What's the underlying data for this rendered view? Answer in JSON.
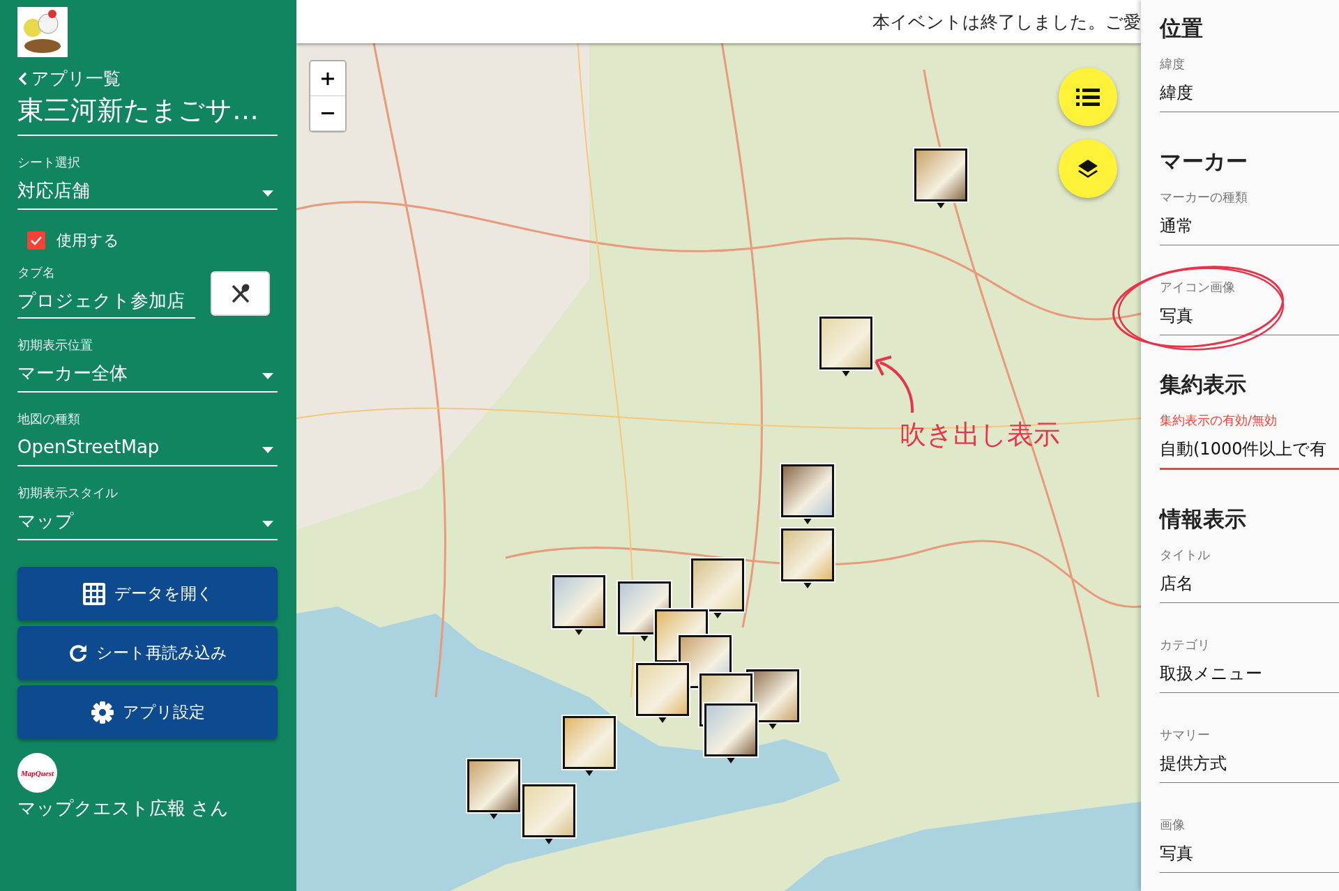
{
  "sidebar": {
    "back_link": "アプリ一覧",
    "app_title": "東三河新たまごサ…",
    "fields": [
      {
        "kind": "select",
        "label": "シート選択",
        "value": "対応店舗"
      },
      {
        "kind": "checkbox",
        "label": "使用する",
        "checked": true
      },
      {
        "kind": "text",
        "label": "タブ名",
        "value": "プロジェクト参加店"
      },
      {
        "kind": "select",
        "label": "初期表示位置",
        "value": "マーカー全体"
      },
      {
        "kind": "select",
        "label": "地図の種類",
        "value": "OpenStreetMap"
      },
      {
        "kind": "select",
        "label": "初期表示スタイル",
        "value": "マップ"
      }
    ],
    "buttons": [
      {
        "kind": "grid",
        "label": "データを開く"
      },
      {
        "kind": "refresh",
        "label": "シート再読み込み"
      },
      {
        "kind": "gear",
        "label": "アプリ設定"
      }
    ],
    "user": {
      "avatar_logo": "MapQuest",
      "name": "マップクエスト広報 さん"
    }
  },
  "map": {
    "banner": "本イベントは終了しました。ご愛"
  },
  "settings": {
    "sections": [
      {
        "heading": "位置",
        "fields": [
          {
            "label": "緯度",
            "value": "緯度",
            "focused": false
          }
        ]
      },
      {
        "heading": "マーカー",
        "fields": [
          {
            "label": "マーカーの種類",
            "value": "通常",
            "focused": false
          },
          {
            "label": "アイコン画像",
            "value": "写真",
            "focused": false
          }
        ]
      },
      {
        "heading": "集約表示",
        "fields": [
          {
            "label": "集約表示の有効/無効",
            "value": "自動(1000件以上で有",
            "focused": true
          }
        ]
      },
      {
        "heading": "情報表示",
        "fields": [
          {
            "label": "タイトル",
            "value": "店名",
            "focused": false
          },
          {
            "label": "カテゴリ",
            "value": "取扱メニュー",
            "focused": false
          },
          {
            "label": "サマリー",
            "value": "提供方式",
            "focused": false
          },
          {
            "label": "画像",
            "value": "写真",
            "focused": false
          }
        ]
      }
    ]
  },
  "annotation": {
    "text": "吹き出し表示"
  }
}
